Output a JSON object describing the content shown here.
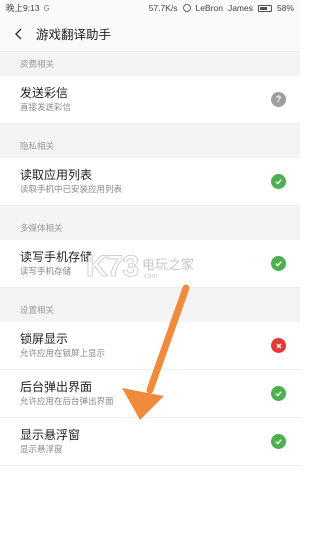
{
  "statusbar": {
    "time": "晚上9:13",
    "speed": "57.7K/s",
    "carrier1": "LeBron",
    "carrier2": "James",
    "battery": "58%",
    "battery_level": 0.58
  },
  "header": {
    "title": "游戏翻译助手",
    "back_icon": "chevron-left-icon"
  },
  "sections": [
    {
      "label": "资费相关",
      "items": [
        {
          "title": "发送彩信",
          "subtitle": "直接发送彩信",
          "status": "ask"
        }
      ]
    },
    {
      "label": "隐私相关",
      "items": [
        {
          "title": "读取应用列表",
          "subtitle": "读取手机中已安装应用列表",
          "status": "allowed"
        }
      ]
    },
    {
      "label": "多媒体相关",
      "items": [
        {
          "title": "读写手机存储",
          "subtitle": "读写手机存储",
          "status": "allowed"
        }
      ]
    },
    {
      "label": "设置相关",
      "items": [
        {
          "title": "锁屏显示",
          "subtitle": "允许应用在锁屏上显示",
          "status": "denied"
        },
        {
          "title": "后台弹出界面",
          "subtitle": "允许应用在后台弹出界面",
          "status": "allowed"
        },
        {
          "title": "显示悬浮窗",
          "subtitle": "显示悬浮窗",
          "status": "allowed"
        }
      ]
    }
  ],
  "watermark": {
    "logo": "K73",
    "text_cn": "电玩之家",
    "url": ".com"
  },
  "colors": {
    "allowed": "#4caf50",
    "denied": "#e53935",
    "ask": "#9e9e9e",
    "arrow": "#f08a3c"
  }
}
